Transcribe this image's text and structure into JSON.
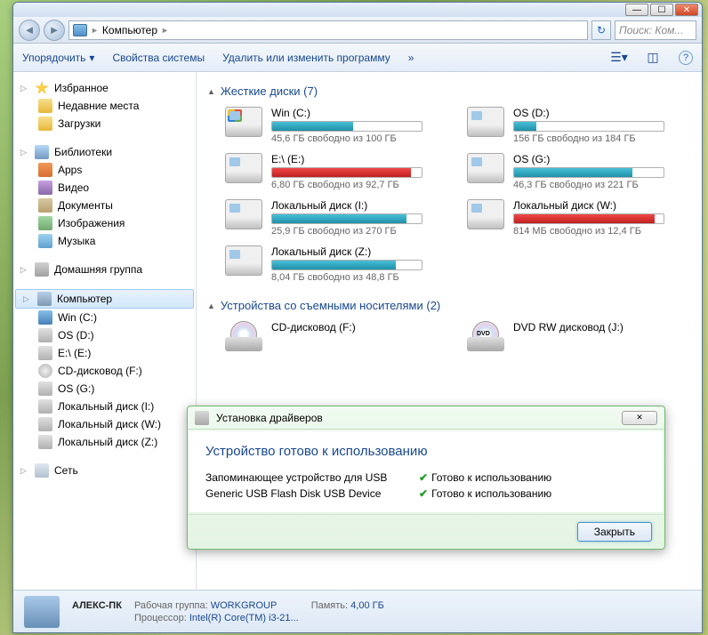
{
  "titlebar": {
    "min": "—",
    "max": "☐",
    "close": "✕"
  },
  "nav": {
    "back": "◄",
    "fwd": "►",
    "breadcrumb": "Компьютер",
    "sep": "►",
    "refresh": "↻",
    "search_placeholder": "Поиск: Ком..."
  },
  "toolbar": {
    "organize": "Упорядочить",
    "dd": "▾",
    "sysprops": "Свойства системы",
    "uninstall": "Удалить или изменить программу",
    "more": "»",
    "help": "?"
  },
  "sidebar": {
    "fav": {
      "label": "Избранное",
      "items": [
        {
          "label": "Недавние места"
        },
        {
          "label": "Загрузки"
        }
      ]
    },
    "lib": {
      "label": "Библиотеки",
      "items": [
        {
          "label": "Apps"
        },
        {
          "label": "Видео"
        },
        {
          "label": "Документы"
        },
        {
          "label": "Изображения"
        },
        {
          "label": "Музыка"
        }
      ]
    },
    "home": {
      "label": "Домашняя группа"
    },
    "comp": {
      "label": "Компьютер",
      "items": [
        {
          "label": "Win (C:)"
        },
        {
          "label": "OS (D:)"
        },
        {
          "label": "E:\\ (E:)"
        },
        {
          "label": "CD-дисковод (F:)"
        },
        {
          "label": "OS (G:)"
        },
        {
          "label": "Локальный диск (I:)"
        },
        {
          "label": "Локальный диск (W:)"
        },
        {
          "label": "Локальный диск (Z:)"
        }
      ]
    },
    "net": {
      "label": "Сеть"
    }
  },
  "sections": {
    "hdd": "Жесткие диски (7)",
    "rem": "Устройства со съемными носителями (2)"
  },
  "drives": [
    {
      "name": "Win (C:)",
      "free": "45,6 ГБ свободно из 100 ГБ",
      "fill": 54,
      "color": "teal",
      "oswin": true
    },
    {
      "name": "OS (D:)",
      "free": "156 ГБ свободно из 184 ГБ",
      "fill": 15,
      "color": "teal"
    },
    {
      "name": "E:\\ (E:)",
      "free": "6,80 ГБ свободно из 92,7 ГБ",
      "fill": 93,
      "color": "red"
    },
    {
      "name": "OS (G:)",
      "free": "46,3 ГБ свободно из 221 ГБ",
      "fill": 79,
      "color": "teal"
    },
    {
      "name": "Локальный диск (I:)",
      "free": "25,9 ГБ свободно из 270 ГБ",
      "fill": 90,
      "color": "teal"
    },
    {
      "name": "Локальный диск (W:)",
      "free": "814 МБ свободно из 12,4 ГБ",
      "fill": 94,
      "color": "red"
    },
    {
      "name": "Локальный диск (Z:)",
      "free": "8,04 ГБ свободно из 48,8 ГБ",
      "fill": 83,
      "color": "teal"
    }
  ],
  "removable": [
    {
      "name": "CD-дисковод (F:)",
      "dvd": false
    },
    {
      "name": "DVD RW дисковод (J:)",
      "dvd": true
    }
  ],
  "status": {
    "name": "АЛЕКС-ПК",
    "workgroup_lbl": "Рабочая группа:",
    "workgroup": "WORKGROUP",
    "mem_lbl": "Память:",
    "mem": "4,00 ГБ",
    "cpu_lbl": "Процессор:",
    "cpu": "Intel(R) Core(TM) i3-21..."
  },
  "popup": {
    "title": "Установка драйверов",
    "close": "✕",
    "header": "Устройство готово к использованию",
    "rows": [
      {
        "dev": "Запоминающее устройство для USB",
        "status": "Готово к использованию"
      },
      {
        "dev": "Generic USB Flash Disk USB Device",
        "status": "Готово к использованию"
      }
    ],
    "btn": "Закрыть"
  }
}
